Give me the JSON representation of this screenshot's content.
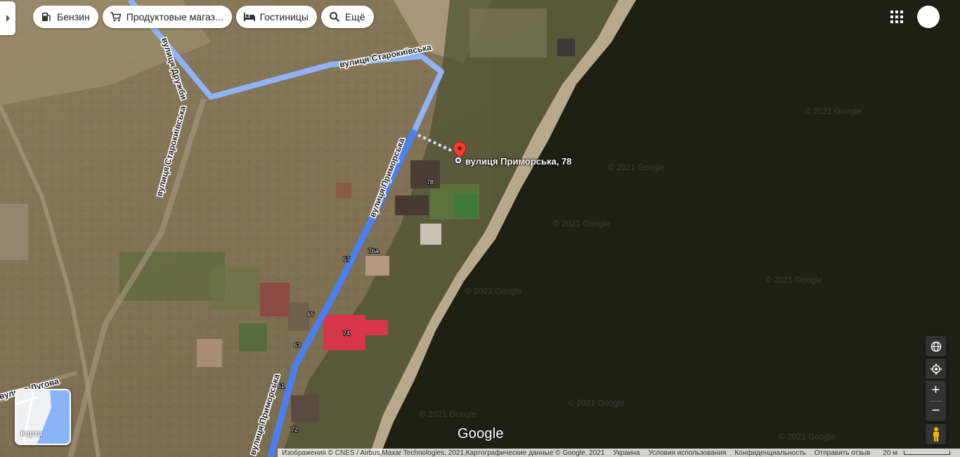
{
  "chips": [
    {
      "label": "Бензин",
      "icon": "fuel-pump-icon"
    },
    {
      "label": "Продуктовые магаз...",
      "icon": "shopping-cart-icon"
    },
    {
      "label": "Гостиницы",
      "icon": "bed-icon"
    },
    {
      "label": "Ещё",
      "icon": "search-icon"
    }
  ],
  "place": {
    "label": "вулиця Приморська, 78"
  },
  "streets": {
    "starokyivska_top": "вулиця Старокиївська",
    "druzhby": "вулиця Дружби",
    "starokyivska_left": "вулиця Старокиївська",
    "prymorska_top": "вулиця Приморська",
    "prymorska_bottom": "вулиця Приморська",
    "luhova": "вулиця Лугова"
  },
  "house_numbers": [
    "78",
    "76а",
    "67",
    "65",
    "74",
    "63",
    "61",
    "72"
  ],
  "watermark": "© 2021 Google",
  "layer_switcher": {
    "label": "Карта"
  },
  "logo": "Google",
  "footer": {
    "imagery": "Изображения © CNES / Airbus,Maxar Technologies, 2021,Картографические данные © Google, 2021",
    "country": "Украина",
    "terms": "Условия использования",
    "privacy": "Конфиденциальность",
    "feedback": "Отправить отзыв",
    "scale": "20 м"
  },
  "colors": {
    "route": "#4a80f5",
    "route_light": "#8fb3f7",
    "water": "#1d2013",
    "pin": "#ea4335"
  }
}
